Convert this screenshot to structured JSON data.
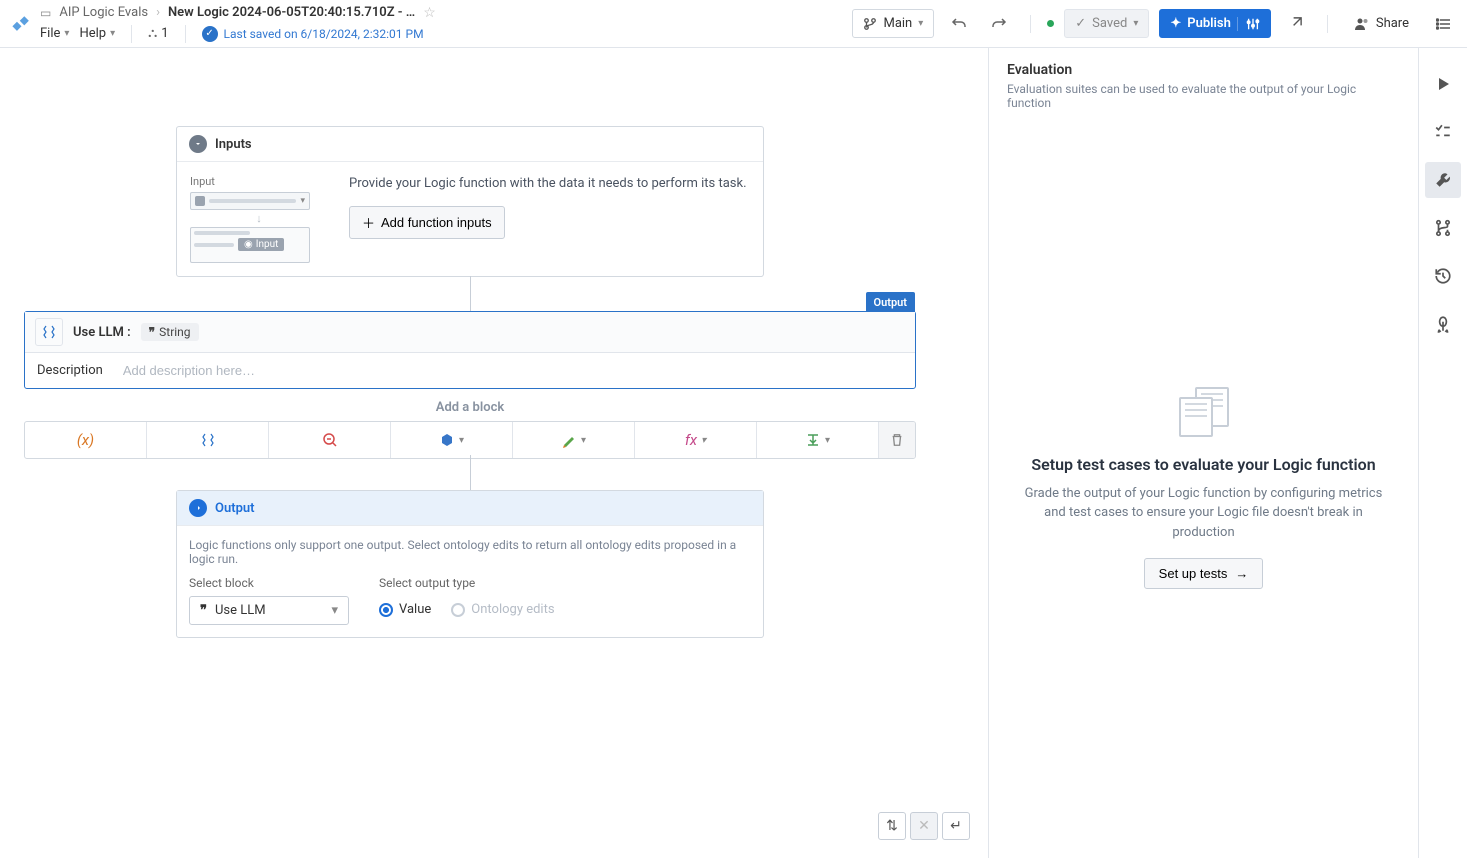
{
  "topbar": {
    "breadcrumb_folder": "AIP Logic Evals",
    "breadcrumb_title": "New Logic 2024-06-05T20:40:15.710Z - …",
    "file_menu": "File",
    "help_menu": "Help",
    "user_count": "1",
    "saved_text": "Last saved on 6/18/2024, 2:32:01 PM",
    "branch_btn": "Main",
    "saved_btn": "Saved",
    "publish_btn": "Publish",
    "share_btn": "Share"
  },
  "inputs": {
    "header": "Inputs",
    "preview_label": "Input",
    "preview_badge": "Input",
    "desc": "Provide your Logic function with the data it needs to perform its task.",
    "add_btn": "Add function inputs"
  },
  "llm": {
    "output_badge": "Output",
    "title": "Use LLM",
    "type": "String",
    "desc_label": "Description",
    "desc_placeholder": "Add description here…"
  },
  "addblock": {
    "label": "Add a block"
  },
  "output": {
    "header": "Output",
    "note": "Logic functions only support one output. Select ontology edits to return all ontology edits proposed in a logic run.",
    "select_block_label": "Select block",
    "select_block_value": "Use LLM",
    "select_output_label": "Select output type",
    "radio_value": "Value",
    "radio_ontology": "Ontology edits"
  },
  "eval": {
    "title": "Evaluation",
    "subtitle": "Evaluation suites can be used to evaluate the output of your Logic function",
    "empty_title": "Setup test cases to evaluate your Logic function",
    "empty_desc": "Grade the output of your Logic function by configuring metrics and test cases to ensure your Logic file doesn't break in production",
    "setup_btn": "Set up tests"
  }
}
